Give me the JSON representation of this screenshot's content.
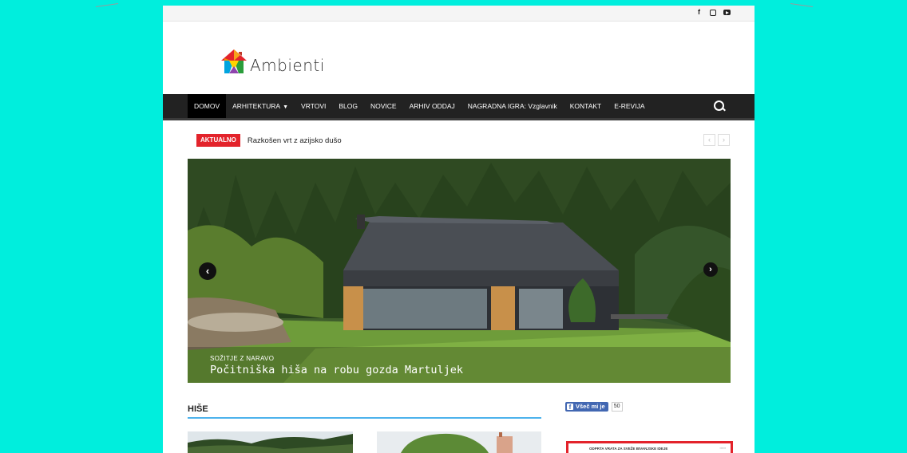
{
  "topbar": {
    "social": [
      "facebook-icon",
      "instagram-icon",
      "youtube-icon"
    ]
  },
  "logo": {
    "text": "Ambienti"
  },
  "nav": {
    "items": [
      {
        "label": "DOMOV",
        "active": true
      },
      {
        "label": "ARHITEKTURA",
        "dropdown": true
      },
      {
        "label": "VRTOVI"
      },
      {
        "label": "BLOG"
      },
      {
        "label": "NOVICE"
      },
      {
        "label": "ARHIV ODDAJ"
      },
      {
        "label": "NAGRADNA IGRA: Vzglavnik"
      },
      {
        "label": "KONTAKT"
      },
      {
        "label": "E-REVIJA"
      }
    ]
  },
  "ticker": {
    "badge": "AKTUALNO",
    "text": "Razkošen vrt z azijsko dušo"
  },
  "hero": {
    "category": "SOŽITJE Z NARAVO",
    "title": "Počitniška hiša na robu gozda Martuljek"
  },
  "section": {
    "title": "HIŠE"
  },
  "facebook": {
    "label": "Všeč mi je",
    "count": "50"
  },
  "ad": {
    "text": "ODPRTA VRATA ZA SVEŽE BIVANJSKE IDEJE"
  },
  "colors": {
    "accent": "#4db2ec",
    "badge": "#e3232b",
    "nav": "#222222",
    "background": "#00eedd"
  }
}
